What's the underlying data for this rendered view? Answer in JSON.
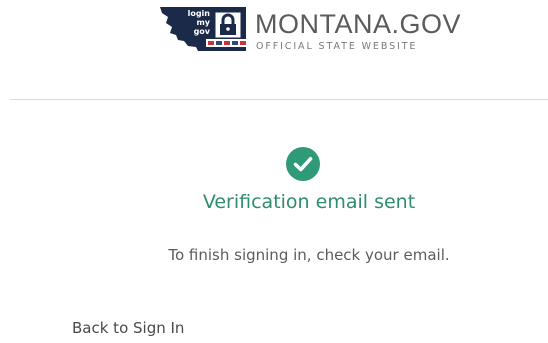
{
  "header": {
    "logo": {
      "badge_lines": [
        "login",
        "my",
        "gov"
      ],
      "title": "MONTANA.GOV",
      "subtitle": "OFFICIAL STATE WEBSITE",
      "map_color": "#1c2a4a",
      "icon": "lock-icon"
    }
  },
  "status": {
    "icon": "check-circle-icon",
    "icon_color": "#2f9a78",
    "title": "Verification email sent",
    "title_color": "#2f8c6f",
    "message": "To finish signing in, check your email."
  },
  "footer": {
    "back_link_label": "Back to Sign In"
  }
}
